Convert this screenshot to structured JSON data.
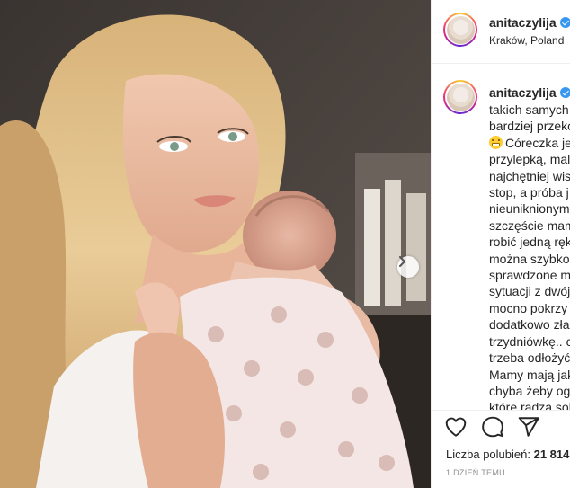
{
  "header": {
    "username": "anitaczylija",
    "location": "Kraków, Poland"
  },
  "post": {
    "author": "anitaczylija",
    "caption_lines": [
      "takich samych",
      "bardziej przeko",
      "Córeczka je",
      "przylepką, mal",
      "najchętniej wis",
      "stop, a próba j",
      "nieuniknionym",
      "szczęście mam",
      "robić jedną ręk",
      "można szybko",
      "sprawdzone m",
      "sytuacji z dwój",
      "mocno pokrzy",
      "dodatkowo zła",
      "trzydniówkę.. c",
      "trzeba odłożyć",
      "Mamy mają jak",
      "chyba żeby og",
      "które radzą sol"
    ]
  },
  "actions": {
    "like_icon": "heart-outline-icon",
    "comment_icon": "comment-bubble-icon",
    "share_icon": "paper-plane-icon"
  },
  "likes": {
    "label": "Liczba polubień:",
    "count": "21 814"
  },
  "timestamp": "1 DZIEŃ TEMU",
  "carousel": {
    "next_icon": "chevron-right-icon"
  }
}
